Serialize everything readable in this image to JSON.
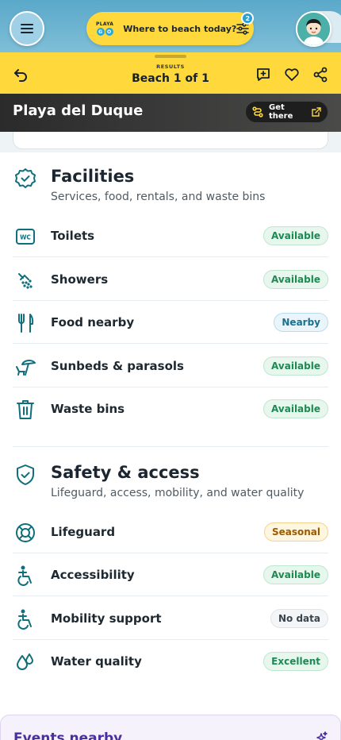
{
  "header": {
    "logo_top": "PLAYA",
    "logo_letters": [
      "G",
      "O"
    ],
    "search_label": "Where to beach today?",
    "filter_count": "2"
  },
  "results": {
    "label": "RESULTS",
    "title": "Beach 1 of 1"
  },
  "beach": {
    "name": "Playa del Duque",
    "get_there_label": "Get there"
  },
  "facilities": {
    "title": "Facilities",
    "subtitle": "Services, food, rentals, and waste bins",
    "items": [
      {
        "label": "Toilets",
        "status": "Available",
        "icon": "toilet-icon"
      },
      {
        "label": "Showers",
        "status": "Available",
        "icon": "shower-icon"
      },
      {
        "label": "Food nearby",
        "status": "Nearby",
        "icon": "fork-knife-icon"
      },
      {
        "label": "Sunbeds & parasols",
        "status": "Available",
        "icon": "parasol-icon"
      },
      {
        "label": "Waste bins",
        "status": "Available",
        "icon": "trash-icon"
      }
    ]
  },
  "safety": {
    "title": "Safety & access",
    "subtitle": "Lifeguard, access, mobility, and water quality",
    "items": [
      {
        "label": "Lifeguard",
        "status": "Seasonal",
        "icon": "lifebuoy-icon"
      },
      {
        "label": "Accessibility",
        "status": "Available",
        "icon": "accessibility-icon"
      },
      {
        "label": "Mobility support",
        "status": "No data",
        "icon": "accessibility-icon"
      },
      {
        "label": "Water quality",
        "status": "Excellent",
        "icon": "water-drop-icon"
      }
    ]
  },
  "events": {
    "title": "Events nearby"
  },
  "colors": {
    "accent_yellow": "#ffd93b",
    "icon_teal": "#0f6f7c",
    "status_green": "#1c8a52",
    "status_blue": "#1b6f8f",
    "status_amber": "#9a5b00",
    "events_purple": "#4b2fa0"
  }
}
